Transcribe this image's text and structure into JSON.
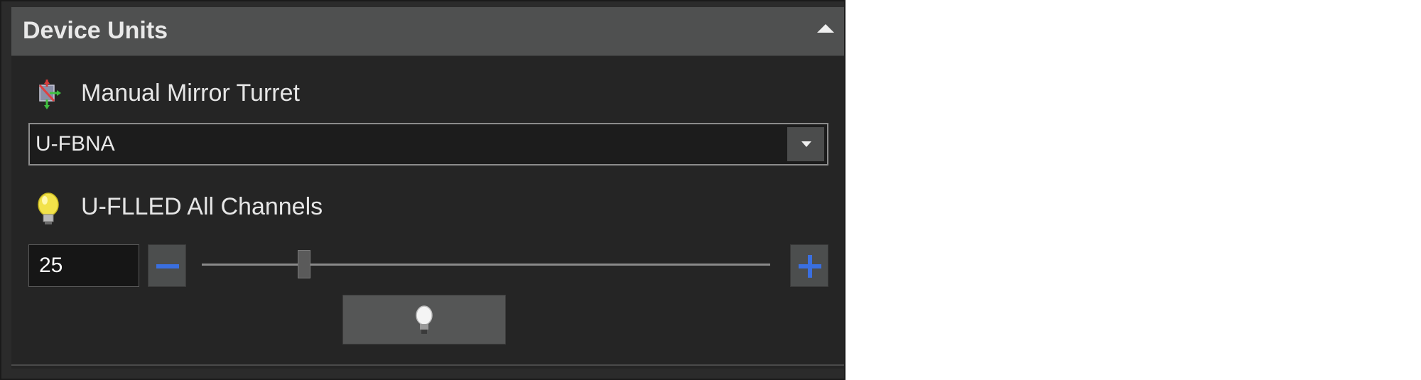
{
  "panel": {
    "title": "Device Units",
    "collapse_icon": "caret-up-icon"
  },
  "mirror_turret": {
    "label": "Manual Mirror Turret",
    "icon": "mirror-turret-icon",
    "selected_value": "U-FBNA"
  },
  "led": {
    "label": "U-FLLED All Channels",
    "icon": "lightbulb-icon",
    "intensity_value": "25",
    "intensity_slider_fraction": 0.18,
    "decrement_icon": "minus-icon",
    "increment_icon": "plus-icon",
    "toggle_icon": "lightbulb-off-icon"
  },
  "colors": {
    "accent_blue": "#3a6fe0",
    "panel_bg": "#252525",
    "header_bg": "#4f5050"
  }
}
